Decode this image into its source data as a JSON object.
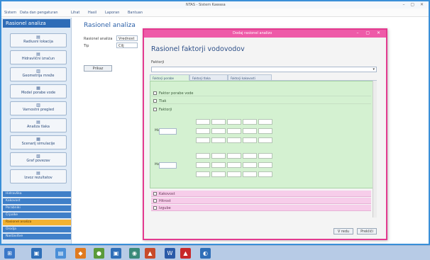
{
  "window": {
    "title": "NTAS - Sistem Kawasa",
    "controls": "– ▢ ✕"
  },
  "menubar": {
    "items": [
      "Sistem",
      "Data dan pengaturan",
      "Lihat",
      "Hasil",
      "Laporan",
      "Bantuan"
    ]
  },
  "sidebar": {
    "title": "Rasionel analiza",
    "tools": [
      {
        "icon": "▤",
        "label": "Radiusni lokacija"
      },
      {
        "icon": "▤",
        "label": "Hidravlični izračun"
      },
      {
        "icon": "▥",
        "label": "Geometrija mreže"
      },
      {
        "icon": "▦",
        "label": "Model porabe vode"
      },
      {
        "icon": "▥",
        "label": "Varnostni pregled"
      },
      {
        "icon": "▤",
        "label": "Analiza tlaka"
      },
      {
        "icon": "▦",
        "label": "Scenarij simulacije"
      },
      {
        "icon": "▧",
        "label": "Graf povezav"
      },
      {
        "icon": "▤",
        "label": "Izvoz rezultatov"
      }
    ],
    "nav": [
      {
        "label": "Hidravlika",
        "selected": false
      },
      {
        "label": "Kakovost",
        "selected": false
      },
      {
        "label": "Porabniki",
        "selected": false
      },
      {
        "label": "Črpalke",
        "selected": false
      },
      {
        "label": "Rasionel analiza",
        "selected": true
      },
      {
        "label": "Orodja",
        "selected": false
      },
      {
        "label": "Nastavitve",
        "selected": false
      }
    ]
  },
  "main": {
    "heading": "Rasionel analiza",
    "fields": [
      {
        "label": "Rasionel analiza",
        "value": "Vrednost"
      },
      {
        "label": "Tip",
        "value": "Cilj"
      }
    ],
    "action_button": "Prikaz"
  },
  "dialog": {
    "title": "Dodaj rasionel analizo",
    "controls": "– ▢ ✕",
    "heading": "Rasionel faktorji vodovodov",
    "section_label": "Faktorji",
    "select1": "",
    "select2": "",
    "tabs": [
      "Faktorji porabe",
      "Faktorji tlaka",
      "Faktorji kakovosti"
    ],
    "rows": [
      {
        "label": "Faktor porabe vode",
        "pink": false
      },
      {
        "label": "Tlak",
        "pink": false
      }
    ],
    "sub_check": "Faktorji",
    "group1": {
      "caption": "",
      "input_label": "Min",
      "input_value": "",
      "rows": [
        {
          "label": "",
          "cells": [
            "",
            "",
            "",
            "",
            ""
          ]
        },
        {
          "label": "",
          "cells": [
            "",
            "",
            "",
            "",
            ""
          ]
        },
        {
          "label": "",
          "cells": [
            "",
            "",
            "",
            "",
            ""
          ]
        }
      ]
    },
    "group2": {
      "caption": "",
      "input_label": "Max",
      "input_value": "",
      "rows": [
        {
          "label": "",
          "cells": [
            "",
            "",
            "",
            "",
            ""
          ]
        },
        {
          "label": "",
          "cells": [
            "",
            "",
            "",
            "",
            ""
          ]
        },
        {
          "label": "",
          "cells": [
            "",
            "",
            "",
            "",
            ""
          ]
        }
      ]
    },
    "note": "",
    "pink_rows": [
      "Kakovost",
      "Hitrost",
      "Izgube"
    ],
    "buttons": {
      "ok": "V redu",
      "cancel": "Prekliči"
    }
  },
  "taskbar": {
    "clock": ""
  }
}
